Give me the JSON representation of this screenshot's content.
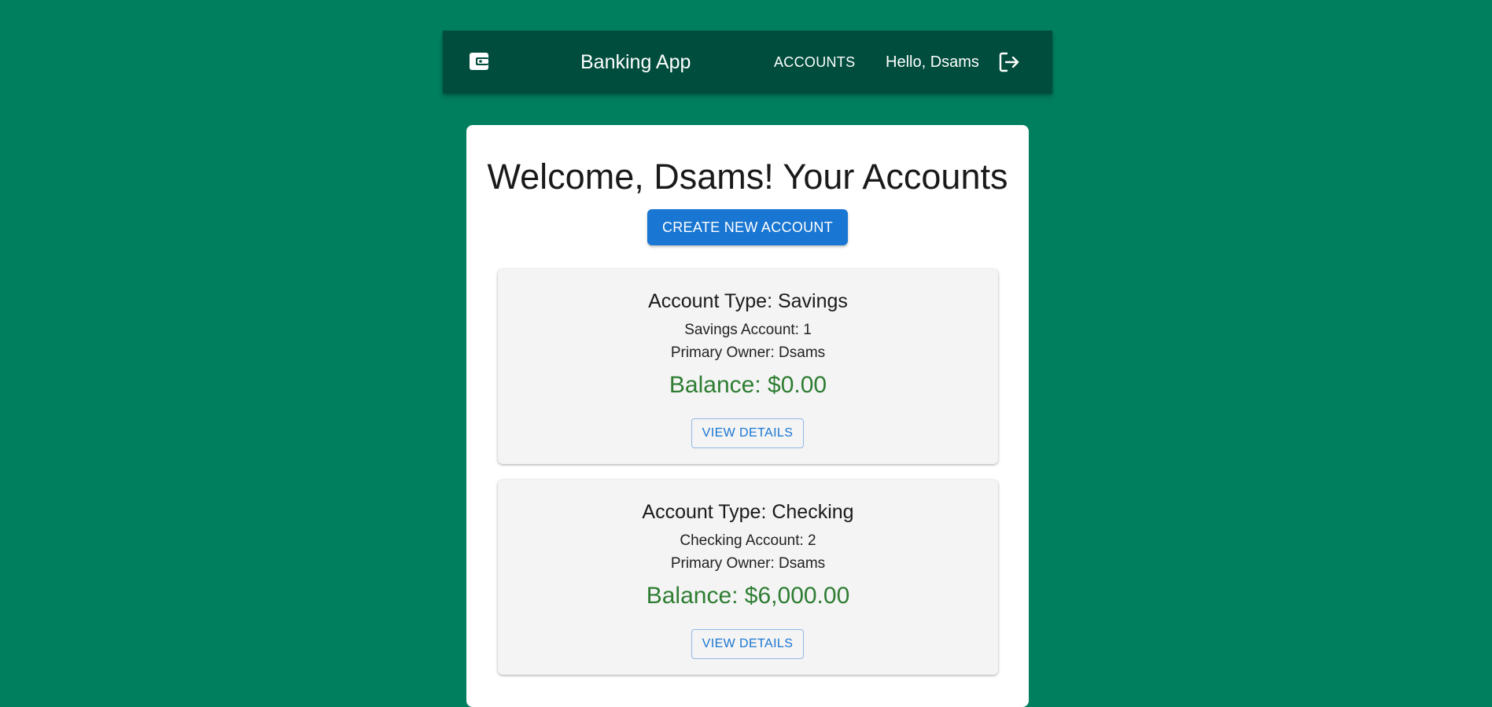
{
  "header": {
    "app_title": "Banking App",
    "nav_accounts_label": "ACCOUNTS",
    "greeting": "Hello, Dsams",
    "icons": {
      "logo": "wallet-icon",
      "logout": "logout-icon"
    }
  },
  "main": {
    "title": "Welcome, Dsams! Your Accounts",
    "create_button_label": "CREATE NEW ACCOUNT",
    "accounts": [
      {
        "type_label": "Account Type: Savings",
        "number_label": "Savings Account: 1",
        "owner_label": "Primary Owner: Dsams",
        "balance_label": "Balance: $0.00",
        "view_button_label": "VIEW DETAILS"
      },
      {
        "type_label": "Account Type: Checking",
        "number_label": "Checking Account: 2",
        "owner_label": "Primary Owner: Dsams",
        "balance_label": "Balance: $6,000.00",
        "view_button_label": "VIEW DETAILS"
      }
    ]
  },
  "colors": {
    "page_background": "#007f5f",
    "appbar_background": "#004d3d",
    "primary_button": "#1976d2",
    "balance_text": "#2e7d32",
    "card_background": "#f4f4f4"
  }
}
